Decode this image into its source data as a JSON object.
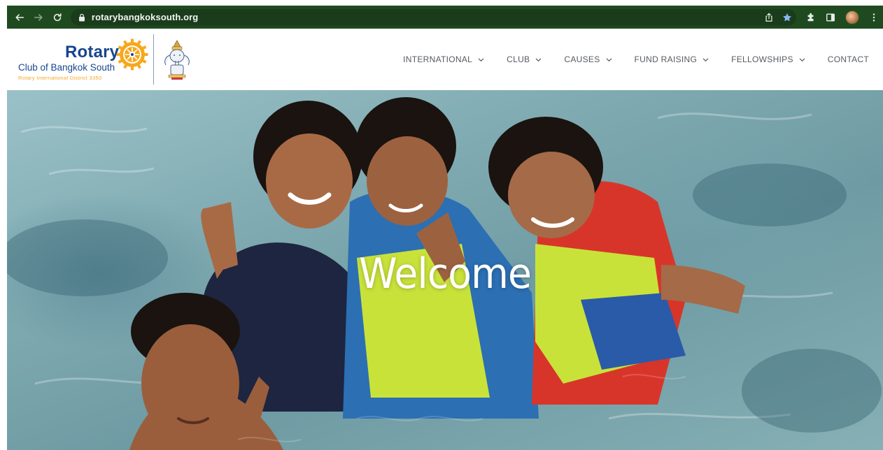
{
  "browser": {
    "url": "rotarybangkoksouth.org",
    "icons": {
      "back": "back-arrow-icon",
      "forward": "forward-arrow-icon",
      "reload": "reload-icon",
      "lock": "lock-icon",
      "share": "share-icon",
      "bookmark": "star-icon",
      "extensions": "puzzle-icon",
      "side_panel": "side-panel-icon",
      "profile": "profile-avatar",
      "menu": "kebab-menu-icon"
    },
    "colors": {
      "toolbar": "#1f4a20",
      "bookmark_star": "#8ab4f8"
    }
  },
  "site": {
    "logo": {
      "brand": "Rotary",
      "club": "Club of Bangkok South",
      "district": "Rotary International District 3350",
      "colors": {
        "blue": "#17458f",
        "gold": "#f7a81b"
      }
    },
    "nav": [
      {
        "label": "INTERNATIONAL",
        "has_dropdown": true
      },
      {
        "label": "CLUB",
        "has_dropdown": true
      },
      {
        "label": "CAUSES",
        "has_dropdown": true
      },
      {
        "label": "FUND RAISING",
        "has_dropdown": true
      },
      {
        "label": "FELLOWSHIPS",
        "has_dropdown": true
      },
      {
        "label": "CONTACT",
        "has_dropdown": false
      }
    ]
  },
  "hero": {
    "title": "Welcome"
  }
}
